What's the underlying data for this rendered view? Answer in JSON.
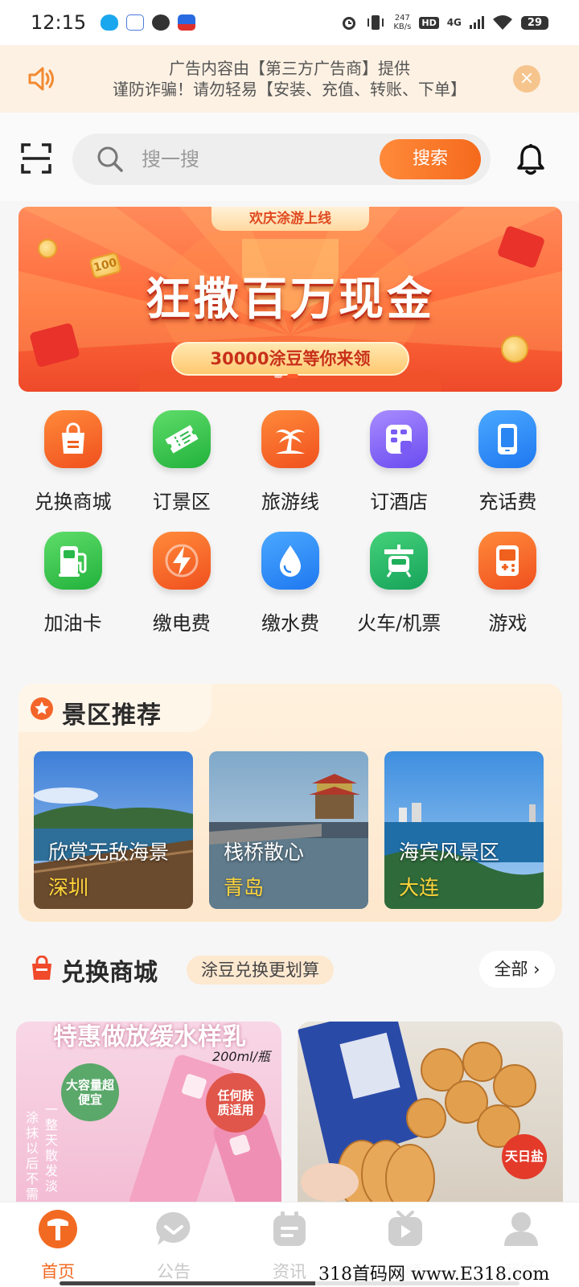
{
  "status_bar": {
    "time": "12:15",
    "net_speed_value": "247",
    "net_speed_unit": "KB/s",
    "hd": "HD",
    "network": "4G",
    "battery": "29"
  },
  "ad_notice": {
    "line1": "广告内容由【第三方广告商】提供",
    "line2": "谨防诈骗！请勿轻易【安装、充值、转账、下单】",
    "close": "×"
  },
  "search": {
    "placeholder": "搜一搜",
    "button_label": "搜索"
  },
  "banner": {
    "tag": "欢庆涂游上线",
    "headline": "狂撒百万现金",
    "subline": "30000涂豆等你来领",
    "coin_text": "100",
    "active_slide": 2,
    "total_slides": 2
  },
  "quick_links": [
    {
      "label": "兑换商城",
      "icon": "shopping-bag-icon",
      "color_from": "#ff8a3a",
      "color_to": "#f0501e"
    },
    {
      "label": "订景区",
      "icon": "ticket-icon",
      "color_from": "#5fdc6a",
      "color_to": "#21b23b"
    },
    {
      "label": "旅游线",
      "icon": "palm-tree-icon",
      "color_from": "#ff8a3a",
      "color_to": "#f0501e"
    },
    {
      "label": "订酒店",
      "icon": "hotel-icon",
      "color_from": "#a88cff",
      "color_to": "#6a4bf0"
    },
    {
      "label": "充话费",
      "icon": "phone-icon",
      "color_from": "#4aa8ff",
      "color_to": "#1f78f0"
    },
    {
      "label": "加油卡",
      "icon": "fuel-pump-icon",
      "color_from": "#5fdc6a",
      "color_to": "#21b23b"
    },
    {
      "label": "缴电费",
      "icon": "lightning-icon",
      "color_from": "#ff8a3a",
      "color_to": "#f0501e"
    },
    {
      "label": "缴水费",
      "icon": "water-drop-icon",
      "color_from": "#4aa8ff",
      "color_to": "#1f78f0"
    },
    {
      "label": "火车/机票",
      "icon": "train-icon",
      "color_from": "#45d17a",
      "color_to": "#16a35a"
    },
    {
      "label": "游戏",
      "icon": "game-console-icon",
      "color_from": "#ff8a3a",
      "color_to": "#f0501e"
    }
  ],
  "scenic": {
    "title": "景区推荐",
    "items": [
      {
        "name": "欣赏无敌海景",
        "city": "深圳"
      },
      {
        "name": "栈桥散心",
        "city": "青岛"
      },
      {
        "name": "海宾风景区",
        "city": "大连"
      }
    ]
  },
  "mall": {
    "title": "兑换商城",
    "badge": "涂豆兑换更划算",
    "all_label": "全部",
    "products": [
      {
        "headline": "特惠做放缓水样乳",
        "volume": "200ml/瓶",
        "sticker_a": "大容量超便宜",
        "sticker_b": "任何肤质适用",
        "side_a": "涂抹以后不需",
        "side_b": "一整天散发淡"
      },
      {
        "tag": "天日盐"
      }
    ]
  },
  "bottom_nav": [
    {
      "label": "首页",
      "icon": "home-icon",
      "active": true
    },
    {
      "label": "公告",
      "icon": "announcement-icon",
      "active": false
    },
    {
      "label": "资讯",
      "icon": "news-icon",
      "active": false
    },
    {
      "label": "视频",
      "icon": "video-icon",
      "active": false
    },
    {
      "label": "我的",
      "icon": "profile-icon",
      "active": false
    }
  ],
  "watermark": "318首码网 www.E318.com",
  "colors": {
    "accent": "#f26a22",
    "ad_bg": "#fdf1e3",
    "city_label": "#ffd43a"
  }
}
